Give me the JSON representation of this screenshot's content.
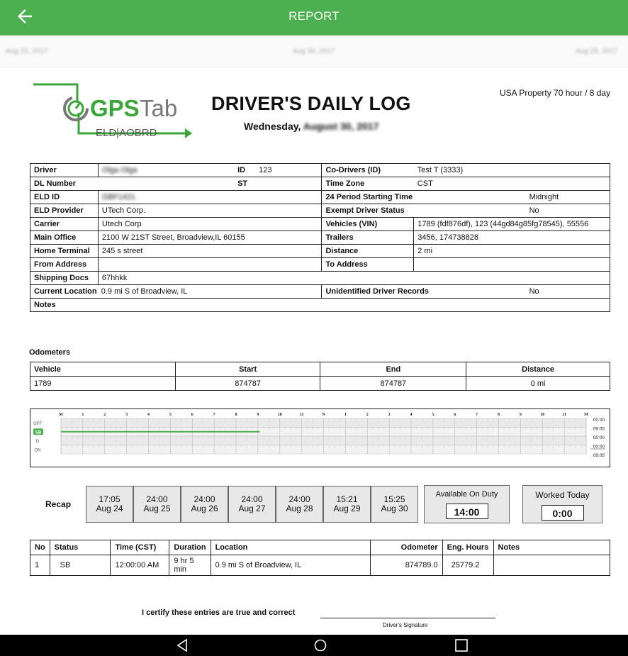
{
  "header": {
    "title": "REPORT",
    "back_icon": "arrow-left-icon"
  },
  "dates": [
    "Aug 31, 2017",
    "Aug 30, 2017",
    "Aug 29, 2017"
  ],
  "logo": {
    "brand_bold": "GPS",
    "brand_light": "Tab",
    "sub": "ELD|AOBRD"
  },
  "log": {
    "title": "DRIVER'S DAILY LOG",
    "weekday": "Wednesday,",
    "date": "August 30, 2017",
    "ruleset": "USA Property 70 hour / 8 day"
  },
  "info": {
    "driver_label": "Driver",
    "driver": "Olga Olga",
    "id_label": "ID",
    "id": "123",
    "codrivers_label": "Co-Drivers (ID)",
    "codrivers": "Test T (3333)",
    "dl_label": "DL Number",
    "dl": "",
    "st_label": "ST",
    "st": "",
    "timezone_label": "Time Zone",
    "timezone": "CST",
    "eld_label": "ELD ID",
    "eld": "GBF1421",
    "period_label": "24 Period Starting Time",
    "period": "Midnight",
    "provider_label": "ELD Provider",
    "provider": "UTech Corp.",
    "exempt_label": "Exempt Driver Status",
    "exempt": "No",
    "carrier_label": "Carrier",
    "carrier": "Utech Corp",
    "vehicles_label": "Vehicles (VIN)",
    "vehicles": "1789 (fdf876df), 123 (44gd84g85fg78545), 55556",
    "office_label": "Main Office",
    "office": "2100 W 21ST Street, Broadview,IL 60155",
    "trailers_label": "Trailers",
    "trailers": "3456, 174738828",
    "terminal_label": "Home Terminal",
    "terminal": "245 s street",
    "distance_label": "Distance",
    "distance": "2 mi",
    "from_label": "From Address",
    "from": "",
    "to_label": "To Address",
    "to": "",
    "shipping_label": "Shipping Docs",
    "shipping": "67hhkk",
    "location_label": "Current Location",
    "location": "0.9 mi S of Broadview, IL",
    "unidentified_label": "Unidentified Driver Records",
    "unidentified": "No",
    "notes_label": "Notes",
    "notes": ""
  },
  "odometers": {
    "title": "Odometers",
    "headers": [
      "Vehicle",
      "Start",
      "End",
      "Distance"
    ],
    "rows": [
      [
        "1789",
        "874787",
        "874787",
        "0 mi"
      ]
    ]
  },
  "graph": {
    "hours": [
      "M",
      "1",
      "2",
      "3",
      "4",
      "5",
      "6",
      "7",
      "8",
      "9",
      "10",
      "11",
      "N",
      "1",
      "2",
      "3",
      "4",
      "5",
      "6",
      "7",
      "8",
      "9",
      "10",
      "11",
      "M"
    ],
    "statuses": [
      "OFF",
      "SB",
      "D",
      "ON"
    ],
    "totals": [
      "00:00",
      "09:05",
      "00:00",
      "00:00",
      "09:05"
    ],
    "active_status": "SB",
    "segment": {
      "from_hour": 0,
      "to_hour": 9.083
    },
    "accent": "#4caf50"
  },
  "recap": {
    "label": "Recap",
    "days": [
      {
        "time": "17:05",
        "date": "Aug 24"
      },
      {
        "time": "24:00",
        "date": "Aug 25"
      },
      {
        "time": "24:00",
        "date": "Aug 26"
      },
      {
        "time": "24:00",
        "date": "Aug 27"
      },
      {
        "time": "24:00",
        "date": "Aug 28"
      },
      {
        "time": "15:21",
        "date": "Aug 29"
      },
      {
        "time": "15:25",
        "date": "Aug 30"
      }
    ],
    "available_label": "Available On Duty",
    "available": "14:00",
    "worked_label": "Worked Today",
    "worked": "0:00"
  },
  "events": {
    "headers": [
      "No",
      "Status",
      "Time (CST)",
      "Duration",
      "Location",
      "Odometer",
      "Eng. Hours",
      "Notes"
    ],
    "rows": [
      [
        "1",
        "SB",
        "12:00:00 AM",
        "9 hr 5 min",
        "0.9 mi S of Broadview, IL",
        "874789.0",
        "25779.2",
        ""
      ]
    ]
  },
  "certify": {
    "text": "I certify these entries are true and correct",
    "signature_caption": "Driver's Signature"
  },
  "nav": {
    "back": "triangle-back-icon",
    "home": "circle-home-icon",
    "recent": "square-recent-icon"
  }
}
